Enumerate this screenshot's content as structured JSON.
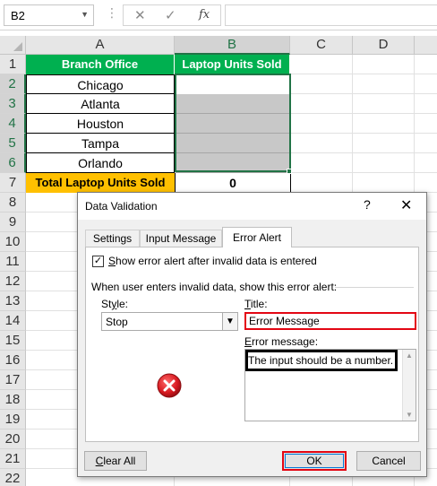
{
  "formula_bar": {
    "name_box": "B2",
    "cancel_glyph": "✕",
    "enter_glyph": "✓",
    "fx_label": "fx",
    "formula": ""
  },
  "columns": [
    "A",
    "B",
    "C",
    "D"
  ],
  "rows": [
    "1",
    "2",
    "3",
    "4",
    "5",
    "6",
    "7",
    "8",
    "9",
    "10",
    "11",
    "12",
    "13",
    "14",
    "15",
    "16",
    "17",
    "18",
    "19",
    "20",
    "21",
    "22"
  ],
  "sheet": {
    "header_a": "Branch Office",
    "header_b": "Laptop Units Sold",
    "cities": [
      "Chicago",
      "Atlanta",
      "Houston",
      "Tampa",
      "Orlando"
    ],
    "total_label": "Total Laptop Units Sold",
    "total_value": "0"
  },
  "dialog": {
    "title": "Data Validation",
    "help": "?",
    "close": "✕",
    "tabs": [
      "Settings",
      "Input Message",
      "Error Alert"
    ],
    "active_tab": "Error Alert",
    "show_alert_checked": true,
    "show_alert_label": "how error alert after invalid data is entered",
    "show_alert_accel": "S",
    "instruction": "When user enters invalid data, show this error alert:",
    "style_accel": "y",
    "style_label": "St",
    "style_label_end": "le:",
    "style_value": "Stop",
    "title_accel": "T",
    "title_label_rest": "itle:",
    "title_value": "Error Message",
    "message_accel": "E",
    "message_label_rest": "rror message:",
    "message_value": "The input should be a number.",
    "clear_accel": "C",
    "clear_rest": "lear All",
    "ok_label": "OK",
    "cancel_label": "Cancel"
  },
  "icons": {
    "error": "stop-error-icon",
    "dropdown": "chevron-down-icon"
  },
  "colors": {
    "header_green": "#00b050",
    "total_orange": "#ffc000",
    "input_grey": "#c8c8c8",
    "selection_green": "#217346",
    "highlight_red": "#e30613"
  }
}
